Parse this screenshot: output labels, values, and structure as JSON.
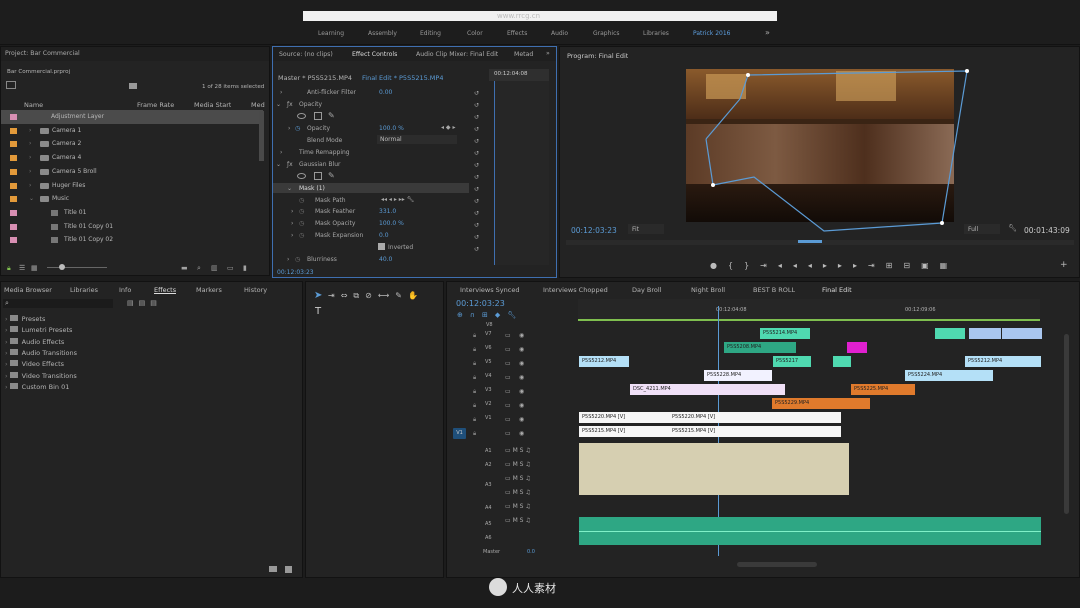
{
  "watermark": "www.rrcg.cn",
  "workspaces": [
    "Learning",
    "Assembly",
    "Editing",
    "Color",
    "Effects",
    "Audio",
    "Graphics",
    "Libraries",
    "Patrick 2016"
  ],
  "project": {
    "title": "Project: Bar Commercial",
    "file": "Bar Commercial.prproj",
    "count": "1 of 28 items selected",
    "cols": [
      "Name",
      "Frame Rate",
      "Media Start",
      "Med"
    ],
    "items": [
      {
        "name": "Adjustment Layer",
        "color": "#d88fb3",
        "folder": false,
        "selected": true
      },
      {
        "name": "Camera 1",
        "color": "#e39a3a",
        "folder": true
      },
      {
        "name": "Camera 2",
        "color": "#e39a3a",
        "folder": true
      },
      {
        "name": "Camera 4",
        "color": "#e39a3a",
        "folder": true
      },
      {
        "name": "Camera 5 Broll",
        "color": "#e39a3a",
        "folder": true
      },
      {
        "name": "Huger Files",
        "color": "#e39a3a",
        "folder": true
      },
      {
        "name": "Music",
        "color": "#e39a3a",
        "folder": true,
        "open": true
      },
      {
        "name": "Title 01",
        "color": "#d88fb3",
        "folder": false,
        "child": true
      },
      {
        "name": "Title 01 Copy 01",
        "color": "#d88fb3",
        "folder": false,
        "child": true
      },
      {
        "name": "Title 01 Copy 02",
        "color": "#d88fb3",
        "folder": false,
        "child": true
      }
    ]
  },
  "effect_controls": {
    "tabs": [
      "Source: (no clips)",
      "Effect Controls",
      "Audio Clip Mixer: Final Edit",
      "Metad"
    ],
    "master": "Master * P5S5215.MP4",
    "seq": "Final Edit * P5S5215.MP4",
    "timecode": "00:12:04:08",
    "current": "00:12:03:23",
    "rows": [
      {
        "label": "Anti-flicker Filter",
        "value": "0.00",
        "indent": 1
      },
      {
        "label": "Opacity",
        "value": "",
        "indent": 0,
        "fx": true
      },
      {
        "label": "Opacity",
        "value": "100.0 %",
        "indent": 1
      },
      {
        "label": "Blend Mode",
        "value": "Normal",
        "indent": 2
      },
      {
        "label": "Time Remapping",
        "value": "",
        "indent": 0
      },
      {
        "label": "Gaussian Blur",
        "value": "",
        "indent": 0,
        "fx": true
      },
      {
        "label": "Mask (1)",
        "value": "",
        "indent": 1
      },
      {
        "label": "Mask Path",
        "value": "",
        "indent": 2
      },
      {
        "label": "Mask Feather",
        "value": "331.0",
        "indent": 2
      },
      {
        "label": "Mask Opacity",
        "value": "100.0 %",
        "indent": 2
      },
      {
        "label": "Mask Expansion",
        "value": "0.0",
        "indent": 2
      },
      {
        "label": "Inverted",
        "value": "",
        "indent": 3
      },
      {
        "label": "Blurriness",
        "value": "40.0",
        "indent": 1
      }
    ]
  },
  "program": {
    "title": "Program: Final Edit",
    "current": "00:12:03:23",
    "fit": "Fit",
    "full": "Full",
    "duration": "00:01:43:09"
  },
  "effects": {
    "tabs": [
      "Media Browser",
      "Libraries",
      "Info",
      "Effects",
      "Markers",
      "History"
    ],
    "items": [
      "Presets",
      "Lumetri Presets",
      "Audio Effects",
      "Audio Transitions",
      "Video Effects",
      "Video Transitions",
      "Custom Bin 01"
    ]
  },
  "timeline": {
    "tabs": [
      "Interviews Synced",
      "Interviews Chopped",
      "Day Broll",
      "Night Broll",
      "BEST B ROLL",
      "Final Edit"
    ],
    "current": "00:12:03:23",
    "ticks": [
      "00:12:04:08",
      "00:12:09:06"
    ],
    "video_tracks": [
      "V8",
      "V7",
      "V6",
      "V5",
      "V4",
      "V3",
      "V2",
      "V1"
    ],
    "audio_tracks": [
      "A1",
      "A2",
      "A3",
      "A4",
      "A5",
      "A6"
    ],
    "master": "Master",
    "master_val": "0.0",
    "src": "V1",
    "clips": {
      "p14": "P5S5214.MP4",
      "p08": "P5S5208.MP4",
      "p17": "P5S5217",
      "p21": "P5S5212.MP4",
      "p23": "P5S5228.MP4",
      "p24": "P5S5224.MP4",
      "dsc": "DSC_4211.MP4",
      "p25": "P5S5225.MP4",
      "p29": "P5S5229.MP4",
      "p15a": "P5S5215.MP4 [V]",
      "p15b": "P5S5215.MP4 [V]",
      "p20": "P5S5220.MP4 [V]",
      "p20b": "P5S5220.MP4 [V]"
    }
  },
  "bottom_logo": "人人素材"
}
